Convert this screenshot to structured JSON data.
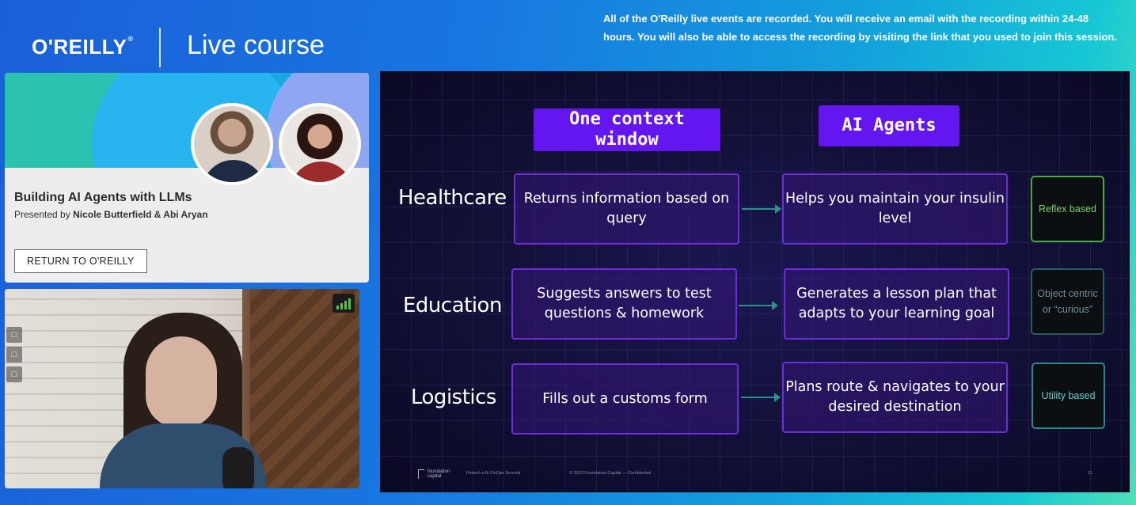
{
  "brand": {
    "logo": "O'REILLY",
    "logo_mark": "®",
    "product": "Live course"
  },
  "notice": "All of the O'Reilly live events are recorded. You will receive an email with the recording within 24-48 hours. You will also be able to access the recording by visiting the link that you used to join this session.",
  "course": {
    "title": "Building AI Agents with LLMs",
    "presented_by": "Presented by",
    "presenters": "Nicole Butterfield & Abi Aryan",
    "return_button": "RETURN TO O'REILLY"
  },
  "video": {
    "signal_icon": "signal-bars-icon",
    "camera_off_icon": "camera-off-icon",
    "signal_color": "#5ac24a"
  },
  "slide": {
    "header_left": "One context window",
    "header_right": "AI Agents",
    "rows": [
      {
        "label": "Healthcare",
        "context": "Returns information based on query",
        "agent": "Helps you maintain your insulin level",
        "type": "Reflex based"
      },
      {
        "label": "Education",
        "context": "Suggests answers to test questions & homework",
        "agent": "Generates a lesson plan that adapts to your learning goal",
        "type": "Object centric or “curious”"
      },
      {
        "label": "Logistics",
        "context": "Fills out a customs form",
        "agent": "Plans route & navigates to your desired destination",
        "type": "Utility based"
      }
    ],
    "footer": {
      "logo_line1": "foundation",
      "logo_line2": "capital",
      "event": "Fintech x AI FinOps Summit",
      "copyright": "© 2023 Foundation Capital — Confidential",
      "page": "11"
    }
  },
  "colors": {
    "accent_purple": "#6416f0",
    "box_border": "#6d2bd9",
    "arrow": "#2f8f8a"
  }
}
